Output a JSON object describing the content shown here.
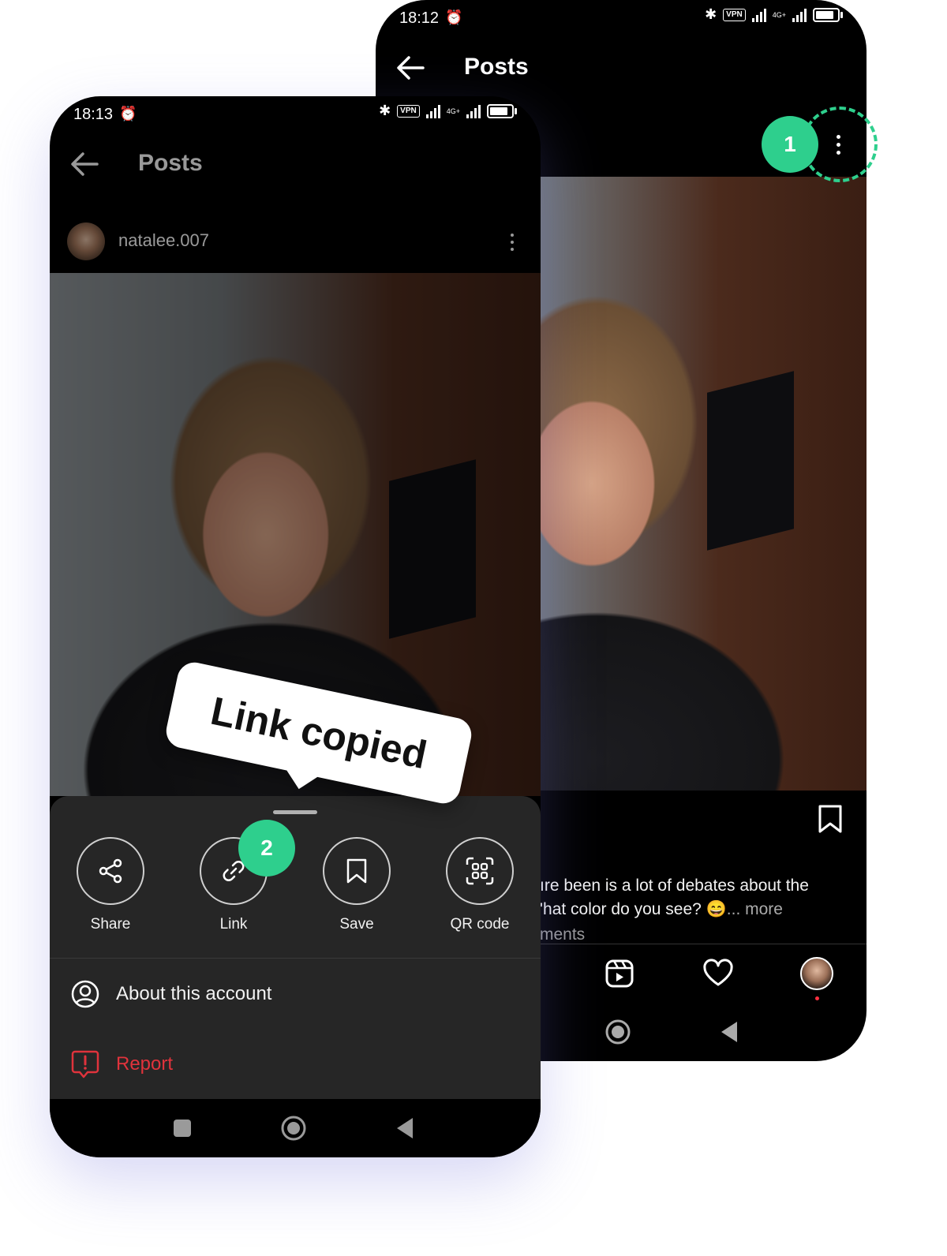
{
  "back_screen": {
    "status_time": "18:12",
    "title": "Posts",
    "caption_line1": "ıre been is a lot of debates about the",
    "caption_line2": "'hat color do you see? 😄",
    "caption_more": "... more",
    "comments_partial": "ments",
    "step_badge": "1"
  },
  "front_screen": {
    "status_time": "18:13",
    "title": "Posts",
    "username": "natalee.007",
    "step_badge": "2",
    "toast": "Link copied",
    "actions": [
      {
        "label": "Share",
        "icon": "share-icon"
      },
      {
        "label": "Link",
        "icon": "link-icon"
      },
      {
        "label": "Save",
        "icon": "bookmark-icon"
      },
      {
        "label": "QR code",
        "icon": "qr-code-icon"
      }
    ],
    "about_label": "About this account",
    "report_label": "Report"
  },
  "status_bar": {
    "vpn": "VPN",
    "network": "4G+"
  },
  "colors": {
    "accent": "#2ecf8d",
    "report": "#e0333c",
    "sheet": "#262626"
  }
}
